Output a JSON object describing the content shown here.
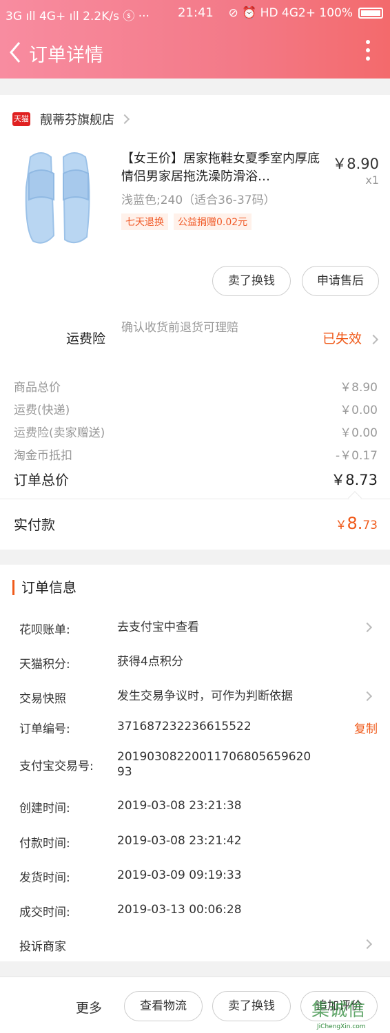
{
  "status_bar": {
    "left": "3G ıll 4G+ ıll 2.2K/s ⓢ ···",
    "time": "21:41",
    "right": "⊘ ⏰ HD 4G2+ 100%"
  },
  "nav": {
    "title": "订单详情"
  },
  "shop": {
    "badge": "天猫",
    "name": "靓蒂芬旗舰店"
  },
  "product": {
    "title": "【女王价】居家拖鞋女夏季室内厚底情侣男家居拖洗澡防滑浴…",
    "price": "￥8.90",
    "qty": "x1",
    "sku": "浅蓝色;240（适合36-37码）",
    "tags": [
      "七天退换",
      "公益捐赠0.02元"
    ],
    "image_color": "#b9d6f2"
  },
  "actions": {
    "sell_label": "卖了换钱",
    "after_sale_label": "申请售后"
  },
  "insurance": {
    "label": "运费险",
    "desc": "确认收货前退货可理赔",
    "status": "已失效"
  },
  "fees": [
    {
      "label": "商品总价",
      "value": "￥8.90"
    },
    {
      "label": "运费(快递)",
      "value": "￥0.00"
    },
    {
      "label": "运费险(卖家赠送)",
      "value": "￥0.00"
    },
    {
      "label": "淘金币抵扣",
      "value": "-￥0.17"
    }
  ],
  "total": {
    "label": "订单总价",
    "value": "￥8.73"
  },
  "paid": {
    "label": "实付款",
    "currency": "￥",
    "int": "8.",
    "dec": "73"
  },
  "order_info": {
    "title": "订单信息",
    "rows": [
      {
        "key": "花呗账单:",
        "value": "去支付宝中查看"
      },
      {
        "key": "天猫积分:",
        "value": "获得4点积分"
      },
      {
        "key": "交易快照",
        "value": "发生交易争议时，可作为判断依据"
      },
      {
        "key": "订单编号:",
        "value": "371687232236615522",
        "action": "复制"
      },
      {
        "key": "支付宝交易号:",
        "value": "2019030822001170680565962093"
      },
      {
        "key": "创建时间:",
        "value": "2019-03-08 23:21:38"
      },
      {
        "key": "付款时间:",
        "value": "2019-03-08 23:21:42"
      },
      {
        "key": "发货时间:",
        "value": "2019-03-09 09:19:33"
      },
      {
        "key": "成交时间:",
        "value": "2019-03-13 00:06:28"
      },
      {
        "key": "投诉商家",
        "value": ""
      }
    ]
  },
  "bottom": {
    "more": "更多",
    "logistics": "查看物流",
    "sell": "卖了换钱",
    "review": "追加评价"
  },
  "watermark": {
    "text": "集诚信",
    "url": "JiChengXin.com"
  },
  "colors": {
    "accent": "#f05a1a",
    "header_start": "#f88ca0",
    "header_end": "#f36a6c"
  }
}
